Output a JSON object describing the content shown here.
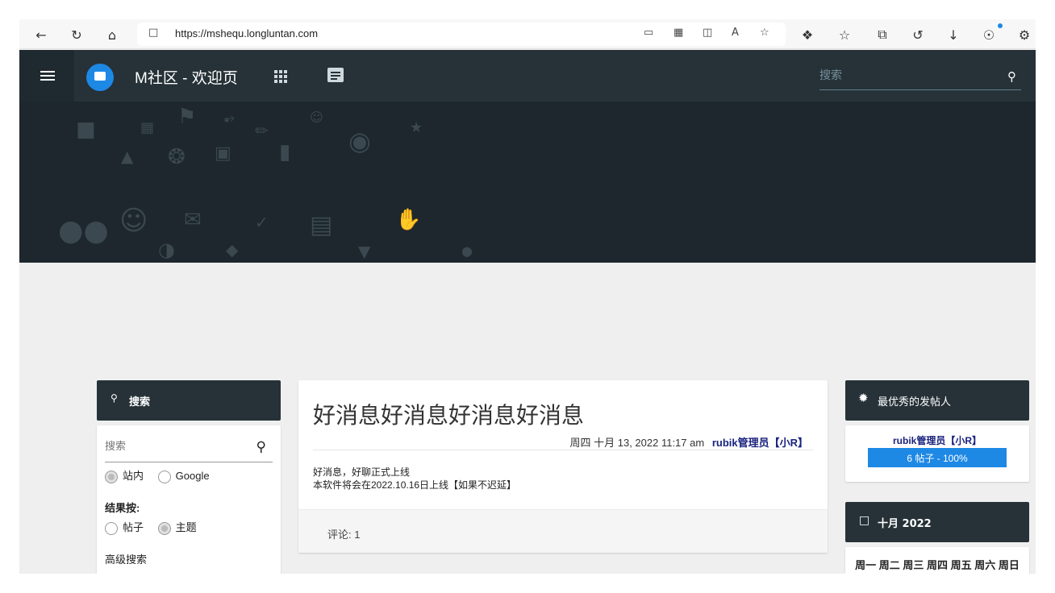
{
  "browser": {
    "url": "https://mshequ.longluntan.com",
    "icons": [
      "back-icon",
      "refresh-icon",
      "home-icon",
      "lock-icon",
      "app-available-icon",
      "qr-icon",
      "split-screen-icon",
      "read-aloud-icon",
      "add-favorite-icon",
      "extensions-icon",
      "favorites-icon",
      "collections-icon",
      "history-icon",
      "downloads-icon",
      "rewards-icon",
      "performance-icon"
    ]
  },
  "header": {
    "site_title": "M社区 - 欢迎页",
    "search_placeholder": "搜索"
  },
  "left_panel": {
    "title": "搜索",
    "search_placeholder": "搜索",
    "scope_options": [
      "站内",
      "Google"
    ],
    "scope_selected": "站内",
    "result_label": "结果按:",
    "result_options": [
      "帖子",
      "主题"
    ],
    "result_selected": "主题",
    "advanced_link": "高级搜索"
  },
  "post": {
    "title": "好消息好消息好消息好消息",
    "date": "周四 十月 13, 2022 11:17 am",
    "author": "rubik管理员【小R】",
    "body_line1": "好消息，好聊正式上线",
    "body_line2": "本软件将会在2022.10.16日上线【如果不迟延】",
    "comments": "评论: 1"
  },
  "right_panel": {
    "top_poster_title": "最优秀的发帖人",
    "top_poster_name": "rubik管理员【小R】",
    "top_poster_stats": "6 帖子 - 100%",
    "top_poster_percent": 100,
    "calendar_title": "十月 2022",
    "weekdays": "周一 周二 周三 周四 周五 周六 周日"
  },
  "colors": {
    "header_bg": "#263238",
    "banner_bg": "#1d272d",
    "accent": "#1e88e5",
    "author_link": "#1a237e"
  }
}
